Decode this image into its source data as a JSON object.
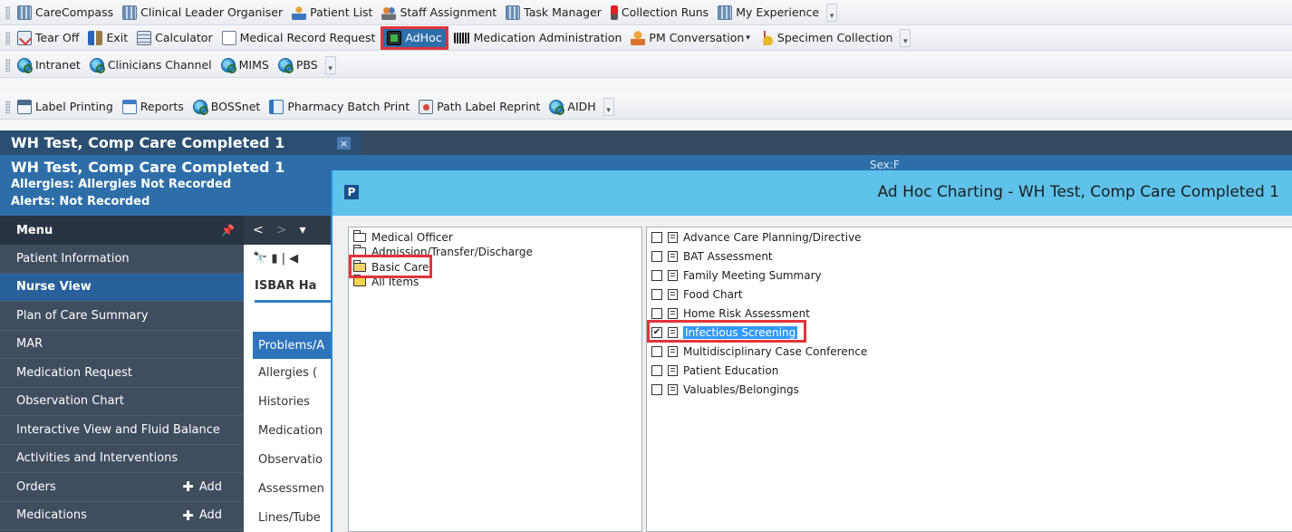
{
  "toolbars": {
    "row1": [
      {
        "label": "CareCompass",
        "icon": "grid-icon"
      },
      {
        "label": "Clinical Leader Organiser",
        "icon": "grid-icon"
      },
      {
        "label": "Patient List",
        "icon": "person-icon"
      },
      {
        "label": "Staff Assignment",
        "icon": "staff-icon"
      },
      {
        "label": "Task Manager",
        "icon": "grid-icon"
      },
      {
        "label": "Collection Runs",
        "icon": "tube-icon"
      },
      {
        "label": "My Experience",
        "icon": "grid-icon"
      }
    ],
    "row2": [
      {
        "label": "Tear Off",
        "icon": "tear-off-icon"
      },
      {
        "label": "Exit",
        "icon": "exit-icon"
      },
      {
        "label": "Calculator",
        "icon": "calculator-icon"
      },
      {
        "label": "Medical Record Request",
        "icon": "document-icon"
      },
      {
        "label": "AdHoc",
        "icon": "adhoc-icon"
      },
      {
        "label": "Medication Administration",
        "icon": "barcode-icon"
      },
      {
        "label": "PM Conversation",
        "icon": "pm-conversation-icon"
      },
      {
        "label": "Specimen Collection",
        "icon": "specimen-icon"
      }
    ],
    "row3": [
      {
        "label": "Intranet",
        "icon": "globe-icon"
      },
      {
        "label": "Clinicians Channel",
        "icon": "globe-icon"
      },
      {
        "label": "MIMS",
        "icon": "globe-icon"
      },
      {
        "label": "PBS",
        "icon": "globe-icon"
      }
    ],
    "row4": [
      {
        "label": "Label Printing",
        "icon": "label-printer-icon"
      },
      {
        "label": "Reports",
        "icon": "reports-icon"
      },
      {
        "label": "BOSSnet",
        "icon": "globe-icon"
      },
      {
        "label": "Pharmacy Batch Print",
        "icon": "pharmacy-icon"
      },
      {
        "label": "Path Label Reprint",
        "icon": "path-label-icon"
      },
      {
        "label": "AIDH",
        "icon": "globe-icon"
      }
    ]
  },
  "tab": {
    "title": "WH Test, Comp Care Completed 1",
    "close": "×"
  },
  "banner": {
    "name": "WH Test, Comp Care Completed 1",
    "allergies": "Allergies: Allergies Not Recorded",
    "alerts": "Alerts: Not Recorded",
    "sex": "Sex:F"
  },
  "menu": {
    "title": "Menu",
    "pin": "ᵖ",
    "items": [
      {
        "label": "Patient Information"
      },
      {
        "label": "Nurse View",
        "active": true
      },
      {
        "label": "Plan of Care Summary"
      },
      {
        "label": "MAR"
      },
      {
        "label": "Medication Request"
      },
      {
        "label": "Observation Chart"
      },
      {
        "label": "Interactive View and Fluid Balance"
      },
      {
        "label": "Activities and Interventions"
      },
      {
        "label": "Orders",
        "add": "Add"
      },
      {
        "label": "Medications",
        "add": "Add"
      }
    ]
  },
  "content": {
    "nav": [
      "<",
      ">",
      "▾"
    ],
    "tools": "🔭 ▮ | ◀",
    "isbar": "ISBAR Ha",
    "section": "Problems/A",
    "items": [
      "Allergies (",
      "Histories",
      "Medication",
      "Observatio",
      "Assessmen",
      "Lines/Tube"
    ]
  },
  "dialog": {
    "icon_letter": "P",
    "caption": "Ad Hoc Charting - WH Test, Comp Care Completed 1",
    "folders": [
      "Medical Officer",
      "Admission/Transfer/Discharge",
      "Basic Care",
      "All Items"
    ],
    "forms": [
      {
        "label": "Advance Care Planning/Directive",
        "checked": false
      },
      {
        "label": "BAT Assessment",
        "checked": false
      },
      {
        "label": "Family Meeting Summary",
        "checked": false
      },
      {
        "label": "Food Chart",
        "checked": false
      },
      {
        "label": "Home Risk Assessment",
        "checked": false
      },
      {
        "label": "Infectious Screening",
        "checked": true
      },
      {
        "label": "Multidisciplinary Case Conference",
        "checked": false
      },
      {
        "label": "Patient Education",
        "checked": false
      },
      {
        "label": "Valuables/Belongings",
        "checked": false
      }
    ]
  },
  "colors": {
    "highlight": "#e3343a",
    "banner": "#2d6ea8",
    "menu": "#3f4d5f",
    "dialog_title": "#5fc2ea",
    "selection": "#3399ff"
  }
}
